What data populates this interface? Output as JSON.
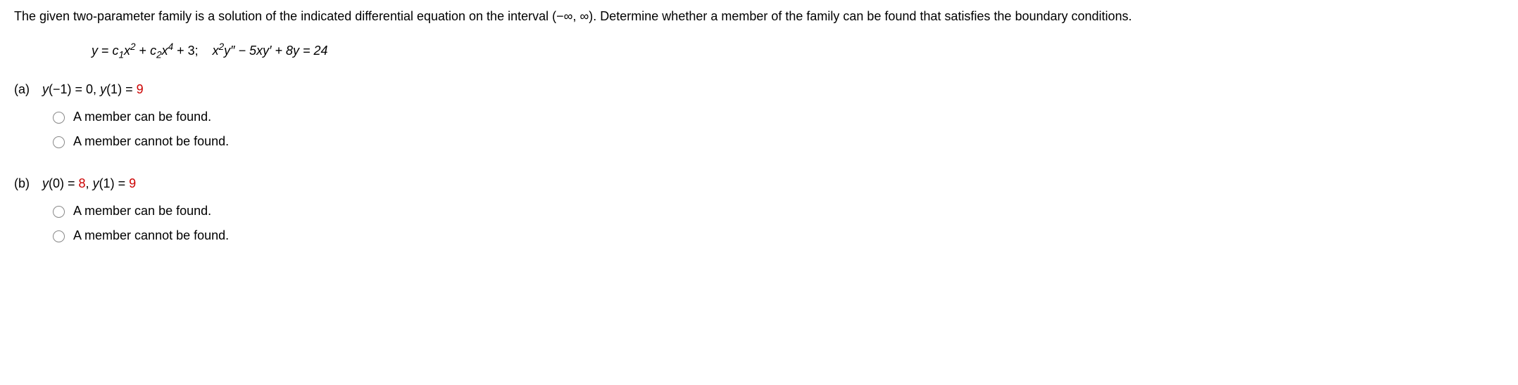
{
  "problem": {
    "intro": "The given two-parameter family is a solution of the indicated differential equation on the interval (−∞, ∞). Determine whether a member of the family can be found that satisfies the boundary conditions."
  },
  "equation": {
    "y_equals": "y",
    "c1": "c",
    "c1_sub": "1",
    "x2": "x",
    "x2_sup": "2",
    "plus1": " + ",
    "c2": "c",
    "c2_sub": "2",
    "x4": "x",
    "x4_sup": "4",
    "const": " + 3;",
    "de_x2": "x",
    "de_x2_sup": "2",
    "de_rest": "y″ − 5xy′ + 8y = 24"
  },
  "parts": {
    "a": {
      "label": "(a)",
      "bc_y1": "y",
      "bc_y1_arg": "(−1) = 0, ",
      "bc_y2": "y",
      "bc_y2_arg": "(1) = ",
      "bc_val": "9",
      "opt1": "A member can be found.",
      "opt2": "A member cannot be found."
    },
    "b": {
      "label": "(b)",
      "bc_y1": "y",
      "bc_y1_arg": "(0) = ",
      "bc_val1": "8",
      "bc_sep": ", ",
      "bc_y2": "y",
      "bc_y2_arg": "(1) = ",
      "bc_val2": "9",
      "opt1": "A member can be found.",
      "opt2": "A member cannot be found."
    }
  }
}
